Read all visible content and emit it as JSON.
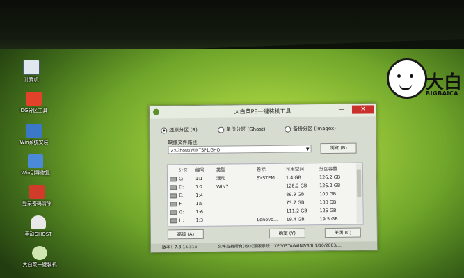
{
  "desktop_icons": [
    {
      "label": "计算机",
      "icon": "computer-icon",
      "color": "#dfe7ef"
    },
    {
      "label": "DG分区工具",
      "icon": "diskgenius-icon",
      "color": "#e2412a"
    },
    {
      "label": "Win系统安装",
      "icon": "windows-setup-icon",
      "color": "#3c78c8"
    },
    {
      "label": "Win引导修复",
      "icon": "boot-repair-icon",
      "color": "#4a8ad8"
    },
    {
      "label": "登录密码清除",
      "icon": "password-clear-icon",
      "color": "#d13b2a"
    },
    {
      "label": "手动GHOST",
      "icon": "ghost-icon",
      "color": "#e8e8e8"
    },
    {
      "label": "大白菜一键装机",
      "icon": "installer-icon",
      "color": "#cfe6b0"
    }
  ],
  "logo": {
    "text_cn": "大白",
    "text_en": "BIGBAICA"
  },
  "dialog": {
    "title": "大白菜PE一键装机工具",
    "min_label": "—",
    "close_label": "✕",
    "options": [
      "还原分区 (R)",
      "备份分区 (Ghost)",
      "备份分区 (Imagex)"
    ],
    "image_path_label": "映像文件路径",
    "image_path_value": "Z:\\Ghost\\WINTSP1.GHO",
    "browse_label": "浏览 (B)",
    "table": {
      "headers": [
        "分区",
        "编号",
        "类型",
        "卷标",
        "可用空间",
        "分区容量"
      ],
      "rows": [
        [
          "C:",
          "1:1",
          "活动",
          "SYSTEM...",
          "1.4 GB",
          "126.2 GB"
        ],
        [
          "D:",
          "1:2",
          "WIN7",
          "",
          "126.2 GB",
          "126.2 GB"
        ],
        [
          "E:",
          "1:4",
          "",
          "",
          "89.9 GB",
          "100 GB"
        ],
        [
          "F:",
          "1:5",
          "",
          "",
          "73.7 GB",
          "100 GB"
        ],
        [
          "G:",
          "1:6",
          "",
          "",
          "111.2 GB",
          "125 GB"
        ],
        [
          "H:",
          "1:3",
          "",
          "Lenovo...",
          "19.4 GB",
          "19.5 GB"
        ]
      ]
    },
    "advanced_label": "高级 (A)",
    "ok_label": "确定 (Y)",
    "cancel_label": "关闭 (C)",
    "status_version": "版本：7.3.15.316",
    "status_support": "文件支持所有(ISO)源版系统：XP/VISTA/WIN7/8/8.1/10/2003/..."
  },
  "colors": {
    "close_button": "#c9302c",
    "accent_green": "#9fcc3e"
  }
}
